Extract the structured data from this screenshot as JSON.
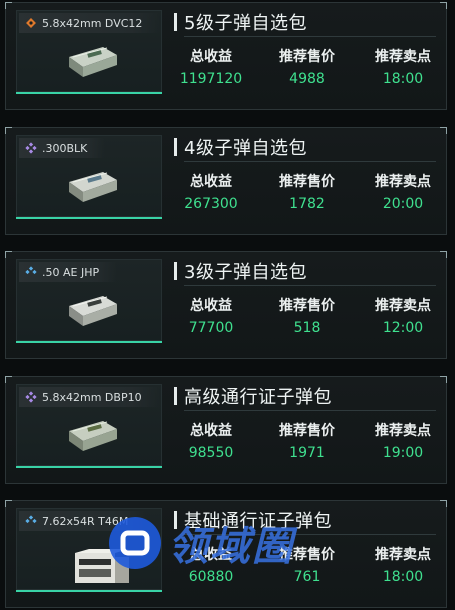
{
  "stat_labels": {
    "revenue": "总收益",
    "price": "推荐售价",
    "time": "推荐卖点"
  },
  "packs": [
    {
      "tag": "5.8x42mm DVC12",
      "tag_icon": "orange-diamond-icon",
      "tag_color": "#e07a2c",
      "title": "5级子弹自选包",
      "revenue": "1197120",
      "price": "4988",
      "time": "18:00"
    },
    {
      "tag": ".300BLK",
      "tag_icon": "purple-diamond-icon",
      "tag_color": "#a88ae6",
      "title": "4级子弹自选包",
      "revenue": "267300",
      "price": "1782",
      "time": "20:00"
    },
    {
      "tag": ".50 AE JHP",
      "tag_icon": "blue-diamond-icon",
      "tag_color": "#5aaee6",
      "title": "3级子弹自选包",
      "revenue": "77700",
      "price": "518",
      "time": "12:00"
    },
    {
      "tag": "5.8x42mm DBP10",
      "tag_icon": "purple-diamond-icon",
      "tag_color": "#a88ae6",
      "title": "高级通行证子弹包",
      "revenue": "98550",
      "price": "1971",
      "time": "19:00"
    },
    {
      "tag": "7.62x54R T46M",
      "tag_icon": "blue-diamond-icon",
      "tag_color": "#5aaee6",
      "title": "基础通行证子弹包",
      "revenue": "60880",
      "price": "761",
      "time": "18:00"
    }
  ],
  "watermark": {
    "text": "领域圈",
    "logo": "lingyuquan-logo"
  }
}
